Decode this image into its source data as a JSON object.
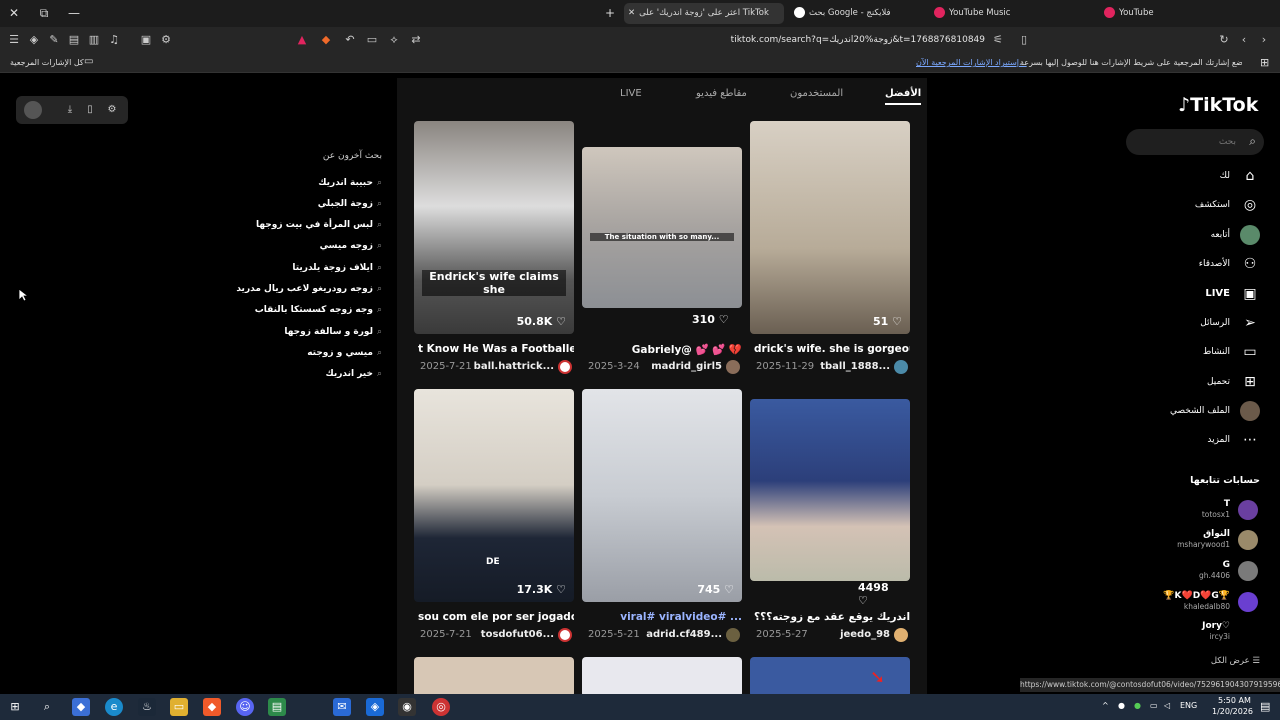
{
  "browser": {
    "tabs": [
      {
        "label": "YouTube",
        "color": "#e0245e"
      },
      {
        "label": "YouTube Music",
        "color": "#e0245e"
      },
      {
        "label": "بحث Google - فلايكنج",
        "color": "#4285f4"
      },
      {
        "label": "اعثر على 'زوجة اندريك' على TikTok",
        "color": "#000000",
        "active": true
      }
    ],
    "url": "tiktok.com/search?q=زوجة%20اندريك&t=1768876810849",
    "bookmarks_prompt": "ضع إشارتك المرجعية على شريط الإشارات هنا للوصول إليها بسرعة.",
    "bookmarks_import": "إستيراد الإشارات المرجعية الآن...",
    "bookmarks_all": "كل الإشارات المرجعية"
  },
  "sidebar": {
    "logo": "TikTok",
    "search_placeholder": "بحث",
    "nav": [
      {
        "label": "لك",
        "icon": "home-icon"
      },
      {
        "label": "استكشف",
        "icon": "compass-icon"
      },
      {
        "label": "أتابعه",
        "icon": "following-icon"
      },
      {
        "label": "الأصدقاء",
        "icon": "friends-icon"
      },
      {
        "label": "LIVE",
        "icon": "live-icon"
      },
      {
        "label": "الرسائل",
        "icon": "send-icon"
      },
      {
        "label": "النشاط",
        "icon": "activity-icon"
      },
      {
        "label": "تحميل",
        "icon": "upload-icon"
      },
      {
        "label": "الملف الشخصي",
        "icon": "profile-icon"
      },
      {
        "label": "المزيد",
        "icon": "more-icon"
      }
    ],
    "following_title": "حسابات تتابعها",
    "following": [
      {
        "name": "T",
        "handle": "totosx1",
        "color": "#6a3fa0"
      },
      {
        "name": "النواق",
        "handle": "msharywood1",
        "color": "#9a8a6a"
      },
      {
        "name": "G",
        "handle": "gh.4406",
        "color": "#7a7a7a"
      },
      {
        "name": "🏆K❤️D❤️G🏆",
        "handle": "khaledalb80",
        "color": "#6a3fd0"
      },
      {
        "name": "Jory♡",
        "handle": "ircy3i",
        "color": "#000000"
      }
    ],
    "see_all": "عرض الكل"
  },
  "results": {
    "tabs": [
      {
        "label": "الأفضل",
        "active": true
      },
      {
        "label": "المستخدمون"
      },
      {
        "label": "مقاطع فيديو"
      },
      {
        "label": "LIVE"
      }
    ],
    "cards": [
      {
        "likes": "51",
        "caption": "drick's wife. she is gorgeous...",
        "date": "2025-11-29",
        "user": "tball_1888...",
        "bg": "#c9c1b3",
        "overlay": ""
      },
      {
        "likes": "310",
        "caption": "Gabriely@ 💕 💕 💔",
        "date": "2025-3-24",
        "user": "madrid_girl5",
        "bg": "#9aa3ad",
        "overlay": "The situation with so many..."
      },
      {
        "likes": "50.8K",
        "caption": "t Know He Was a Footballer...",
        "date": "2025-7-21",
        "user": "ball.hattrick...",
        "bg": "#7a7670",
        "overlay": "Endrick's wife claims she"
      },
      {
        "likes": "4498",
        "caption": "اندريك يوقع عقد مع زوجته؟؟؟ ...",
        "date": "2025-5-27",
        "user": "jeedo_98",
        "bg": "#2c3f7a",
        "overlay": ""
      },
      {
        "likes": "745",
        "caption": "viral# viralvideo# ...",
        "date": "2025-5-21",
        "user": "adrid.cf489...",
        "bg": "#d6d8dc",
        "overlay": ""
      },
      {
        "likes": "17.3K",
        "caption": "sou com ele por ser jogador...",
        "date": "2025-7-21",
        "user": "tosdofut06...",
        "bg": "#d9d4cc",
        "overlay": "DE"
      }
    ]
  },
  "related": {
    "title": "بحث آخرون عن",
    "items": [
      "حبيبة اندريك",
      "زوجة الجبلي",
      "لبس المرأة في بيت زوجها",
      "زوجه ميسي",
      "ايلاف زوجة يلدريتا",
      "زوجه رودريغو لاعب ريال مدريد",
      "وجه زوجه كسستكا بالنقاب",
      "لورة و سالفة زوجها",
      "ميسي و زوجته",
      "خير اندريك"
    ]
  },
  "status_url": "https://www.tiktok.com/@contosdofut06/video/7529619043079195960",
  "system": {
    "time": "5:50 AM",
    "date": "1/20/2026",
    "lang": "ENG"
  }
}
